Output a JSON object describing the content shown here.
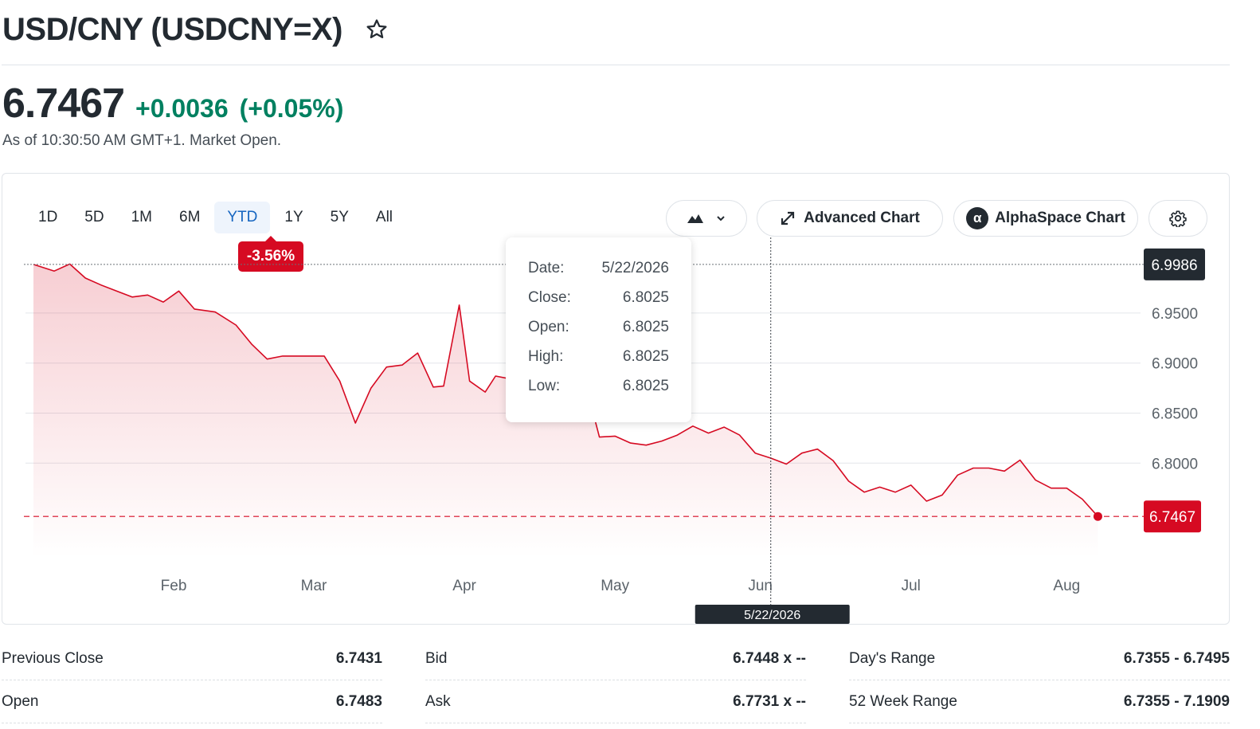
{
  "header": {
    "title": "USD/CNY (USDCNY=X)"
  },
  "quote": {
    "price": "6.7467",
    "change": "+0.0036",
    "change_pct": "(+0.05%)",
    "as_of": "As of 10:30:50 AM GMT+1. Market Open."
  },
  "ranges": [
    "1D",
    "5D",
    "1M",
    "6M",
    "YTD",
    "1Y",
    "5Y",
    "All"
  ],
  "active_range": "YTD",
  "ytd_badge": "-3.56%",
  "toolbar": {
    "advanced_label": "Advanced Chart",
    "alpha_label": "AlphaSpace Chart",
    "alpha_glyph": "α"
  },
  "tooltip": {
    "date_label": "Date:",
    "date": "5/22/2026",
    "close_label": "Close:",
    "close": "6.8025",
    "open_label": "Open:",
    "open": "6.8025",
    "high_label": "High:",
    "high": "6.8025",
    "low_label": "Low:",
    "low": "6.8025"
  },
  "chart_data": {
    "type": "area",
    "x_ticks": [
      "Feb",
      "Mar",
      "Apr",
      "May",
      "Jun",
      "Jul",
      "Aug"
    ],
    "y_ticks": [
      "6.9500",
      "6.9000",
      "6.8500",
      "6.8000"
    ],
    "ylim": [
      6.715,
      7.02
    ],
    "high_label": "6.9986",
    "last_label": "6.7467",
    "crosshair_label": "5/22/2026",
    "line_color": "#d60a22",
    "x_index": [
      0,
      4,
      7,
      10,
      13,
      16,
      19,
      22,
      25,
      28,
      31,
      35,
      39,
      42,
      45,
      48,
      52,
      56,
      59,
      62,
      65,
      68,
      71,
      74,
      77,
      79,
      82,
      84,
      87,
      89,
      92,
      95,
      98,
      102,
      106,
      109,
      112,
      115,
      118,
      121,
      124,
      127,
      130,
      133,
      136,
      139,
      142,
      145,
      148,
      151,
      154,
      157,
      160,
      163,
      166,
      169,
      172,
      175,
      178,
      181,
      184,
      187,
      190,
      193,
      196,
      199,
      202,
      205
    ],
    "values": [
      6.9986,
      6.992,
      6.999,
      6.985,
      6.978,
      6.972,
      6.966,
      6.968,
      6.961,
      6.972,
      6.954,
      6.951,
      6.938,
      6.919,
      6.904,
      6.907,
      6.907,
      6.907,
      6.882,
      6.84,
      6.875,
      6.896,
      6.898,
      6.91,
      6.876,
      6.877,
      6.958,
      6.882,
      6.871,
      6.887,
      6.884,
      6.91,
      6.911,
      6.87,
      6.886,
      6.826,
      6.827,
      6.82,
      6.818,
      6.822,
      6.828,
      6.837,
      6.83,
      6.836,
      6.828,
      6.81,
      6.805,
      6.799,
      6.81,
      6.814,
      6.8025,
      6.782,
      6.771,
      6.776,
      6.771,
      6.778,
      6.762,
      6.768,
      6.788,
      6.795,
      6.795,
      6.792,
      6.803,
      6.783,
      6.775,
      6.775,
      6.764,
      6.7467
    ],
    "x_total": 208,
    "tick_index": [
      27,
      54,
      83,
      112,
      140,
      169,
      199
    ],
    "crosshair_index": 142
  },
  "stats": {
    "col1": [
      {
        "label": "Previous Close",
        "value": "6.7431"
      },
      {
        "label": "Open",
        "value": "6.7483"
      }
    ],
    "col2": [
      {
        "label": "Bid",
        "value": "6.7448 x --"
      },
      {
        "label": "Ask",
        "value": "6.7731 x --"
      }
    ],
    "col3": [
      {
        "label": "Day's Range",
        "value": "6.7355 - 6.7495"
      },
      {
        "label": "52 Week Range",
        "value": "6.7355 - 7.1909"
      }
    ]
  }
}
